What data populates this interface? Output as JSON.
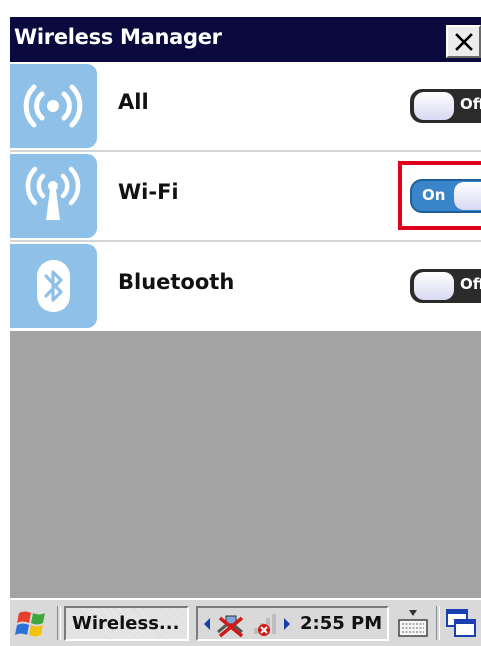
{
  "window": {
    "title": "Wireless Manager",
    "close_label": "×"
  },
  "rows": [
    {
      "label": "All",
      "icon": "wireless-broadcast-icon",
      "toggle_state": "off",
      "toggle_label": "Off"
    },
    {
      "label": "Wi-Fi",
      "icon": "wifi-antenna-icon",
      "toggle_state": "on",
      "toggle_label": "On"
    },
    {
      "label": "Bluetooth",
      "icon": "bluetooth-icon",
      "toggle_state": "off",
      "toggle_label": "Off"
    }
  ],
  "taskbar": {
    "task_label": "Wireless...",
    "time": "2:55 PM"
  },
  "colors": {
    "title_bar": "#0a0a3e",
    "icon_tile": "#8fc1e8",
    "toggle_on": "#3a84c9",
    "highlight": "#e0001b",
    "empty_area": "#a4a3a4"
  }
}
